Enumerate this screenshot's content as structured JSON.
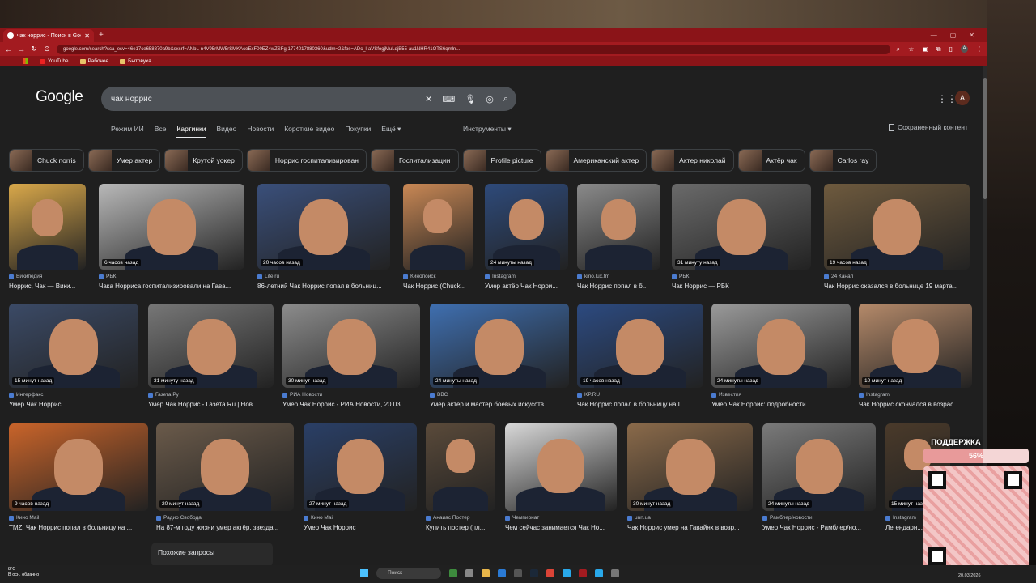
{
  "browser": {
    "tab_title": "чак норрис - Поиск в Google",
    "url": "google.com/search?sca_esv=46e17ce658870a9b&sxsrf=ANbL-n4V95rMW5rSMKAceExF00EZ4wZSFg:1774017880360&udm=2&fbs=ADc_l-aVSfogjMuLdjB55-au1NHR41OTS6qmln...",
    "profile_initial": "A",
    "bookmarks": [
      "YouTube",
      "Рабочее",
      "Бытовуха"
    ]
  },
  "page": {
    "logo": "Google",
    "query": "чак норрис",
    "tabs": [
      "Режим ИИ",
      "Все",
      "Картинки",
      "Видео",
      "Новости",
      "Короткие видео",
      "Покупки",
      "Ещё ▾"
    ],
    "tools": "Инструменты ▾",
    "saved": "Сохраненный контент",
    "related_title": "Похожие запросы",
    "chips": [
      "Chuck norris",
      "Умер актер",
      "Крутой уокер",
      "Норрис госпитализирован",
      "Госпитализации",
      "Profile picture",
      "Американский актер",
      "Актер николай",
      "Актёр чак",
      "Carlos ray"
    ],
    "results": [
      [
        {
          "source": "Википедия",
          "title": "Норрис, Чак — Вики...",
          "badge": "",
          "color": "#d9a84a"
        },
        {
          "source": "РБК",
          "title": "Чака Норриса госпитализировали на Гава...",
          "badge": "6 часов назад",
          "color": "#b8b8b8"
        },
        {
          "source": "Life.ru",
          "title": "86-летний Чак Норрис попал в больниц...",
          "badge": "20 часов назад",
          "color": "#3a4f7a"
        },
        {
          "source": "Кинопоиск",
          "title": "Чак Норрис (Chuck...",
          "badge": "",
          "color": "#c98855"
        },
        {
          "source": "Instagram",
          "title": "Умер актёр Чак Норри...",
          "badge": "24 минуты назад",
          "color": "#2e4a7a"
        },
        {
          "source": "kino.lux.fm",
          "title": "Чак Норрис попал в б...",
          "badge": "",
          "color": "#8a8a8a"
        },
        {
          "source": "РБК",
          "title": "Чак Норрис — РБК",
          "badge": "31 минуту назад",
          "color": "#6a6a6a"
        },
        {
          "source": "24 Канал",
          "title": "Чак Норрис оказался в больнице 19 марта...",
          "badge": "19 часов назад",
          "color": "#6e5a3e"
        }
      ],
      [
        {
          "source": "Интерфакс",
          "title": "Умер Чак Норрис",
          "badge": "15 минут назад",
          "color": "#3b4a66"
        },
        {
          "source": "Газета.Ру",
          "title": "Умер Чак Норрис - Газета.Ru | Нов...",
          "badge": "31 минуту назад",
          "color": "#777777"
        },
        {
          "source": "РИА Новости",
          "title": "Умер Чак Норрис - РИА Новости, 20.03...",
          "badge": "30 минут назад",
          "color": "#8c8c8c"
        },
        {
          "source": "BBC",
          "title": "Умер актер и мастер боевых искусств ...",
          "badge": "24 минуты назад",
          "color": "#3f6fb0"
        },
        {
          "source": "KP.RU",
          "title": "Чак Норрис попал в больницу на Г...",
          "badge": "19 часов назад",
          "color": "#2c4a80"
        },
        {
          "source": "Известия",
          "title": "Умер Чак Норрис: подробности",
          "badge": "24 минуты назад",
          "color": "#9a9a9a"
        },
        {
          "source": "Instagram",
          "title": "Чак Норрис скончался в возрас...",
          "badge": "10 минут назад",
          "color": "#b58a6a"
        }
      ],
      [
        {
          "source": "Кино Mail",
          "title": "TMZ: Чак Норрис попал в больницу на ...",
          "badge": "9 часов назад",
          "color": "#c9642a"
        },
        {
          "source": "Радио Свобода",
          "title": "На 87-м году жизни умер актёр, звезда...",
          "badge": "20 минут назад",
          "color": "#6a5a4a"
        },
        {
          "source": "Кино Mail",
          "title": "Умер Чак Норрис",
          "badge": "27 минут назад",
          "color": "#2a3f66"
        },
        {
          "source": "Анаиас Постер",
          "title": "Купить постер (пл...",
          "badge": "",
          "color": "#5a4a3a"
        },
        {
          "source": "Чемпионат",
          "title": "Чем сейчас занимается Чак Но...",
          "badge": "",
          "color": "#d8d8d8"
        },
        {
          "source": "unn.ua",
          "title": "Чак Норрис умер на Гавайях в возр...",
          "badge": "30 минут назад",
          "color": "#8a6a4a"
        },
        {
          "source": "Рамблер/новости",
          "title": "Умер Чак Норрис - Рамблер/но...",
          "badge": "24 минуты назад",
          "color": "#7a7a7a"
        },
        {
          "source": "Instagram",
          "title": "Легендарн...",
          "badge": "15 минут назад",
          "color": "#4a3a2a"
        }
      ]
    ]
  },
  "overlay": {
    "label": "ПОДДЕРЖКА",
    "progress_text": "56%",
    "progress": 0.56
  },
  "taskbar": {
    "weather_temp": "8°C",
    "weather_desc": "В осн. облачно",
    "search": "Поиск",
    "date": "20.03.2026"
  }
}
